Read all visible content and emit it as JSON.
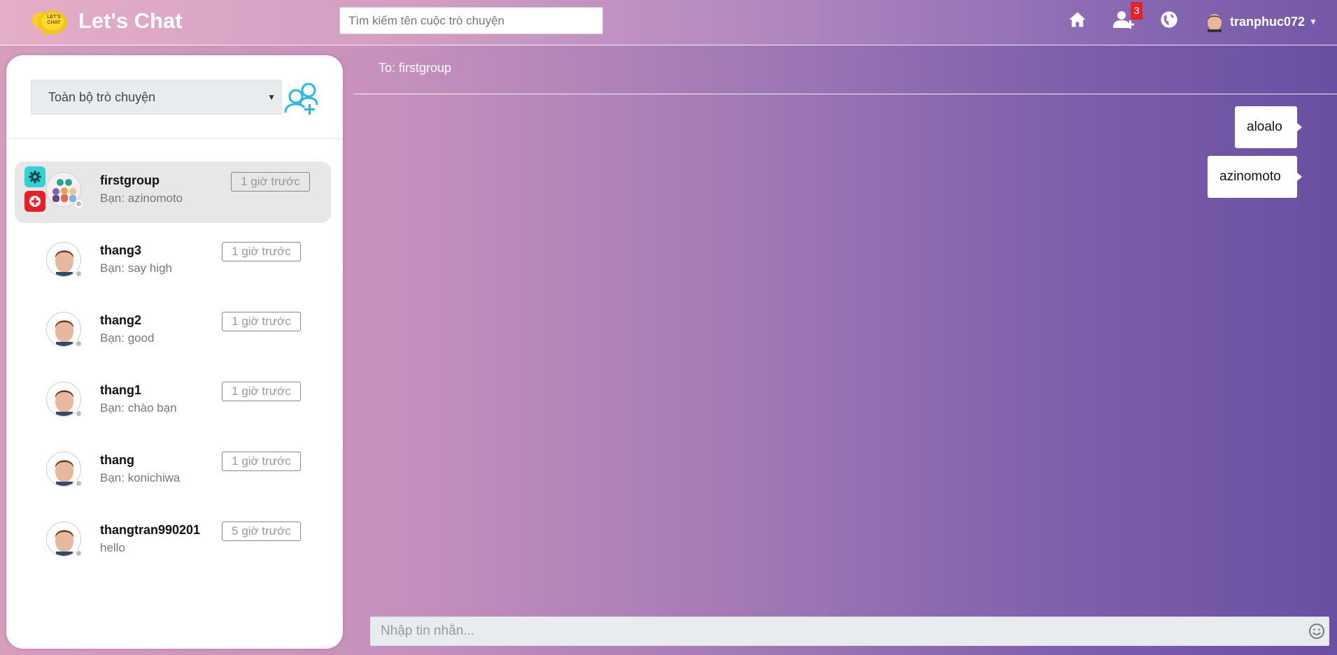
{
  "app": {
    "brand": "Let's Chat",
    "logo_text": "LET'S CHAT"
  },
  "header": {
    "search_placeholder": "Tìm kiếm tên cuộc trò chuyện",
    "friend_requests_count": "3",
    "username": "tranphuc072",
    "icons": [
      "home-icon",
      "add-friend-icon",
      "globe-icon",
      "user-avatar",
      "caret-down-icon"
    ]
  },
  "sidebar": {
    "filter_label": "Toàn bộ trò chuyện",
    "conversations": [
      {
        "name": "firstgroup",
        "preview": "Bạn: azinomoto",
        "time": "1 giờ trước",
        "type": "group",
        "active": true
      },
      {
        "name": "thang3",
        "preview": "Bạn: say high",
        "time": "1 giờ trước",
        "type": "user"
      },
      {
        "name": "thang2",
        "preview": "Bạn: good",
        "time": "1 giờ trước",
        "type": "user"
      },
      {
        "name": "thang1",
        "preview": "Bạn: chào bạn",
        "time": "1 giờ trước",
        "type": "user"
      },
      {
        "name": "thang",
        "preview": "Bạn: konichiwa",
        "time": "1 giờ trước",
        "type": "user"
      },
      {
        "name": "thangtran990201",
        "preview": "hello",
        "time": "5 giờ trước",
        "type": "user"
      }
    ]
  },
  "chat": {
    "to_label": "To: firstgroup",
    "messages": [
      {
        "text": "aloalo",
        "from": "me"
      },
      {
        "text": "azinomoto",
        "from": "me"
      }
    ],
    "compose_placeholder": "Nhập tin nhắn..."
  },
  "colors": {
    "accent_blue": "#29b6e8",
    "badge_red": "#e8202a",
    "settings_teal": "#2ed3d6",
    "leave_red": "#ee1c24"
  }
}
